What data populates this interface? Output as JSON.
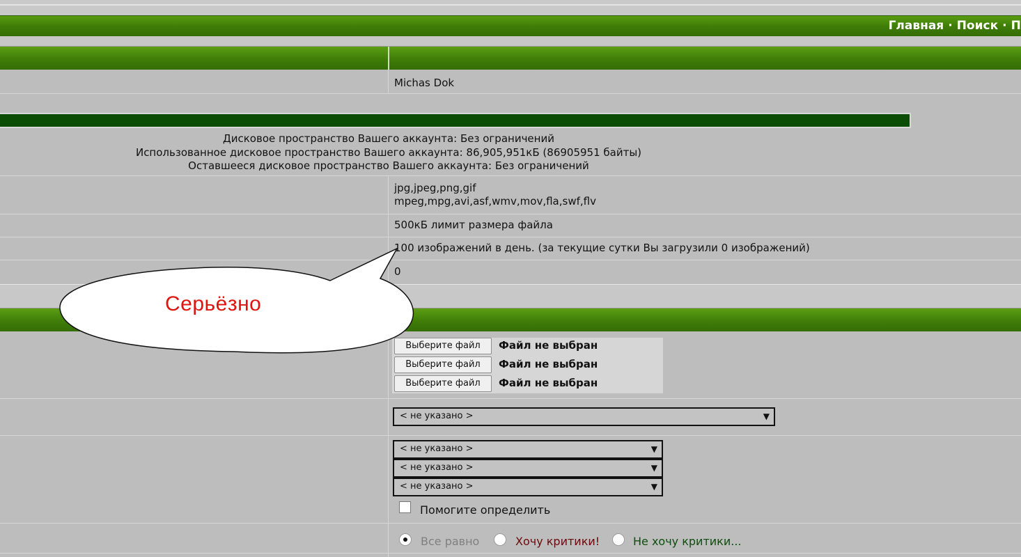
{
  "nav": {
    "links": [
      "Главная",
      "Поиск",
      "Пр"
    ]
  },
  "profile": {
    "username": "Michas Dok"
  },
  "disk": {
    "total": "Дисковое пространство Вашего аккаунта: Без ограничений",
    "used": "Использованное дисковое пространство Вашего аккаунта: 86,905,951кБ (86905951 байты)",
    "remaining": "Оставшееся дисковое пространство Вашего аккаунта: Без ограничений"
  },
  "limits": {
    "image_types": "jpg,jpeg,png,gif",
    "video_types": "mpeg,mpg,avi,asf,wmv,mov,fla,swf,flv",
    "file_size": "500кБ лимит размера файла",
    "daily": "100 изображений в день. (за текущие сутки Вы загрузили 0 изображений)",
    "count": "0"
  },
  "bubble": {
    "text": "Серьёзно"
  },
  "upload": {
    "button_label": "Выберите файл",
    "status": "Файл не выбран"
  },
  "selects": {
    "placeholder": "< не указано >"
  },
  "help": {
    "label": "Помогите определить"
  },
  "critique": {
    "options": [
      "Все равно",
      "Хочу критики!",
      "Не хочу критики..."
    ],
    "colors": [
      "#808080",
      "#6b0a0a",
      "#0d4d0d"
    ],
    "selected": 0
  }
}
